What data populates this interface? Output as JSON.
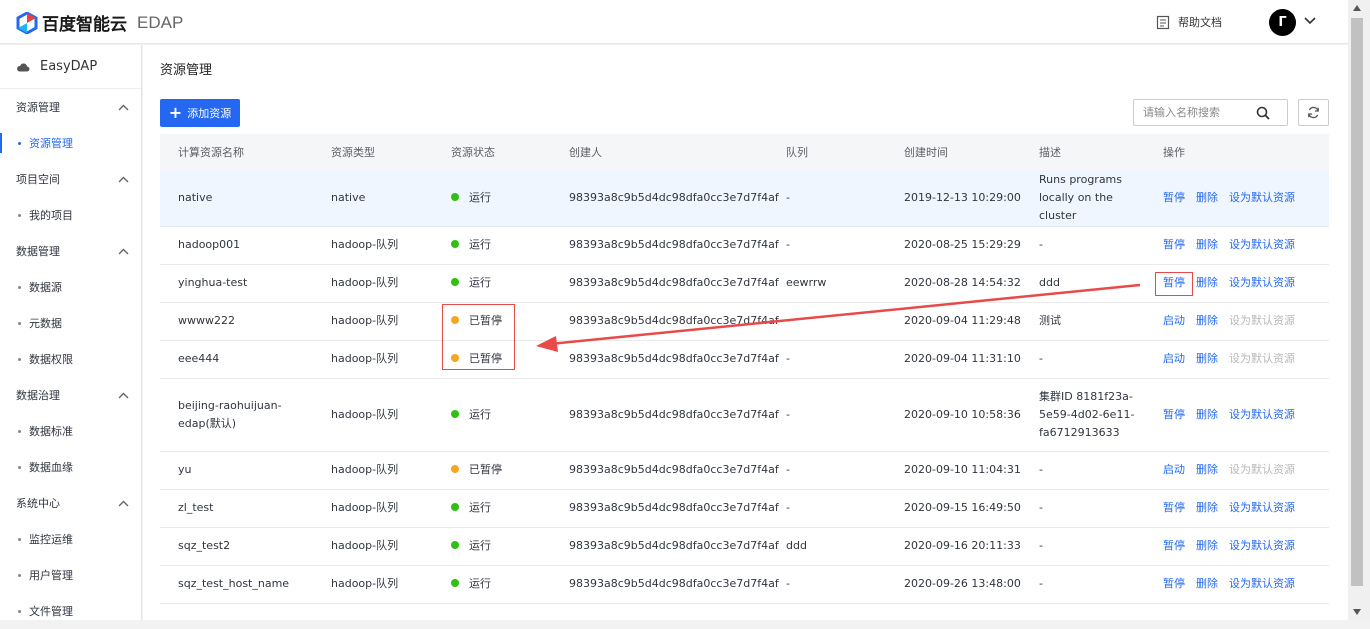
{
  "header": {
    "brand_name": "百度智能云",
    "product": "EDAP",
    "help_label": "帮助文档",
    "avatar_letter": "Γ"
  },
  "sidebar": {
    "brand": "EasyDAP",
    "groups": [
      {
        "label": "资源管理",
        "items": [
          {
            "label": "资源管理",
            "active": true
          }
        ]
      },
      {
        "label": "项目空间",
        "items": [
          {
            "label": "我的项目"
          }
        ]
      },
      {
        "label": "数据管理",
        "items": [
          {
            "label": "数据源"
          },
          {
            "label": "元数据"
          },
          {
            "label": "数据权限"
          }
        ]
      },
      {
        "label": "数据治理",
        "items": [
          {
            "label": "数据标准"
          },
          {
            "label": "数据血缘"
          }
        ]
      },
      {
        "label": "系统中心",
        "items": [
          {
            "label": "监控运维"
          },
          {
            "label": "用户管理"
          },
          {
            "label": "文件管理"
          }
        ]
      }
    ]
  },
  "page": {
    "title": "资源管理",
    "add_button": "添加资源",
    "search_placeholder": "请输入名称搜索"
  },
  "table": {
    "columns": [
      "计算资源名称",
      "资源类型",
      "资源状态",
      "创建人",
      "队列",
      "创建时间",
      "描述",
      "操作"
    ],
    "rows": [
      {
        "name": "native",
        "type": "native",
        "status": "运行",
        "status_color": "green",
        "creator": "98393a8c9b5d4dc98dfa0cc3e7d7f4af",
        "queue": "-",
        "created": "2019-12-13 10:29:00",
        "desc": "Runs programs locally on the cluster",
        "actions": [
          "暂停",
          "删除",
          "设为默认资源"
        ],
        "default_enabled": true
      },
      {
        "name": "hadoop001",
        "type": "hadoop-队列",
        "status": "运行",
        "status_color": "green",
        "creator": "98393a8c9b5d4dc98dfa0cc3e7d7f4af",
        "queue": "-",
        "created": "2020-08-25 15:29:29",
        "desc": "-",
        "actions": [
          "暂停",
          "删除",
          "设为默认资源"
        ],
        "default_enabled": true
      },
      {
        "name": "yinghua-test",
        "type": "hadoop-队列",
        "status": "运行",
        "status_color": "green",
        "creator": "98393a8c9b5d4dc98dfa0cc3e7d7f4af",
        "queue": "eewrrw",
        "created": "2020-08-28 14:54:32",
        "desc": "ddd",
        "actions": [
          "暂停",
          "删除",
          "设为默认资源"
        ],
        "default_enabled": true
      },
      {
        "name": "wwww222",
        "type": "hadoop-队列",
        "status": "已暂停",
        "status_color": "orange",
        "creator": "98393a8c9b5d4dc98dfa0cc3e7d7f4af",
        "queue": "-",
        "created": "2020-09-04 11:29:48",
        "desc": "测试",
        "actions": [
          "启动",
          "删除",
          "设为默认资源"
        ],
        "default_enabled": false
      },
      {
        "name": "eee444",
        "type": "hadoop-队列",
        "status": "已暂停",
        "status_color": "orange",
        "creator": "98393a8c9b5d4dc98dfa0cc3e7d7f4af",
        "queue": "-",
        "created": "2020-09-04 11:31:10",
        "desc": "-",
        "actions": [
          "启动",
          "删除",
          "设为默认资源"
        ],
        "default_enabled": false
      },
      {
        "name": "beijing-raohuijuan-edap(默认)",
        "type": "hadoop-队列",
        "status": "运行",
        "status_color": "green",
        "creator": "98393a8c9b5d4dc98dfa0cc3e7d7f4af",
        "queue": "-",
        "created": "2020-09-10 10:58:36",
        "desc": "集群ID 8181f23a-5e59-4d02-6e11-fa6712913633",
        "actions": [
          "暂停",
          "删除",
          "设为默认资源"
        ],
        "default_enabled": true
      },
      {
        "name": "yu",
        "type": "hadoop-队列",
        "status": "已暂停",
        "status_color": "orange",
        "creator": "98393a8c9b5d4dc98dfa0cc3e7d7f4af",
        "queue": "-",
        "created": "2020-09-10 11:04:31",
        "desc": "-",
        "actions": [
          "启动",
          "删除",
          "设为默认资源"
        ],
        "default_enabled": false
      },
      {
        "name": "zl_test",
        "type": "hadoop-队列",
        "status": "运行",
        "status_color": "green",
        "creator": "98393a8c9b5d4dc98dfa0cc3e7d7f4af",
        "queue": "-",
        "created": "2020-09-15 16:49:50",
        "desc": "-",
        "actions": [
          "暂停",
          "删除",
          "设为默认资源"
        ],
        "default_enabled": true
      },
      {
        "name": "sqz_test2",
        "type": "hadoop-队列",
        "status": "运行",
        "status_color": "green",
        "creator": "98393a8c9b5d4dc98dfa0cc3e7d7f4af",
        "queue": "ddd",
        "created": "2020-09-16 20:11:33",
        "desc": "-",
        "actions": [
          "暂停",
          "删除",
          "设为默认资源"
        ],
        "default_enabled": true
      },
      {
        "name": "sqz_test_host_name",
        "type": "hadoop-队列",
        "status": "运行",
        "status_color": "green",
        "creator": "98393a8c9b5d4dc98dfa0cc3e7d7f4af",
        "queue": "-",
        "created": "2020-09-26 13:48:00",
        "desc": "-",
        "actions": [
          "暂停",
          "删除",
          "设为默认资源"
        ],
        "default_enabled": true
      }
    ]
  },
  "colors": {
    "accent": "#2468f2",
    "running": "#30bf13",
    "paused": "#f5a623",
    "annotation": "#e84a4a"
  }
}
